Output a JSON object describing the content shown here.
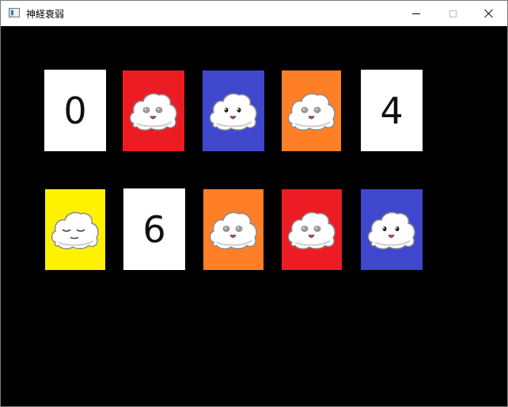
{
  "window": {
    "title": "神経衰弱",
    "icon": "app-window-icon",
    "controls": [
      "minimize-icon",
      "maximize-icon",
      "close-icon"
    ]
  },
  "colors": {
    "red": "#ec1c24",
    "blue": "#3f48cc",
    "orange": "#ff7f27",
    "yellow": "#fff200",
    "white": "#ffffff",
    "background": "#000000"
  },
  "cards": [
    {
      "row": 1,
      "face": "number",
      "value": "0"
    },
    {
      "row": 1,
      "face": "mascot",
      "color": "red",
      "expression": "worried"
    },
    {
      "row": 1,
      "face": "mascot",
      "color": "blue",
      "expression": "smile"
    },
    {
      "row": 1,
      "face": "mascot",
      "color": "orange",
      "expression": "worried"
    },
    {
      "row": 1,
      "face": "number",
      "value": "4"
    },
    {
      "row": 2,
      "face": "mascot",
      "color": "yellow",
      "expression": "sleepy"
    },
    {
      "row": 2,
      "face": "number",
      "value": "6"
    },
    {
      "row": 2,
      "face": "mascot",
      "color": "orange",
      "expression": "worried"
    },
    {
      "row": 2,
      "face": "mascot",
      "color": "red",
      "expression": "worried"
    },
    {
      "row": 2,
      "face": "mascot",
      "color": "blue",
      "expression": "smile"
    }
  ]
}
